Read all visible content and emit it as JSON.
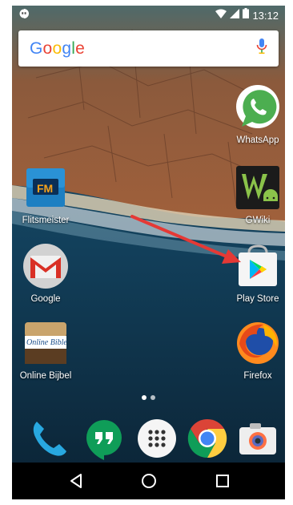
{
  "status_bar": {
    "time": "13:12",
    "icons": [
      "hangouts-notification-icon",
      "wifi-icon",
      "cell-signal-icon",
      "battery-icon"
    ]
  },
  "search": {
    "logo_text": "Google",
    "mic_icon": "mic-icon"
  },
  "home": {
    "apps": [
      {
        "label": "WhatsApp",
        "icon": "whatsapp-icon"
      },
      {
        "label": "Flitsmeister",
        "icon": "flitsmeister-icon"
      },
      {
        "label": "GWiki",
        "icon": "gwiki-icon"
      },
      {
        "label": "Google",
        "icon": "gmail-icon"
      },
      {
        "label": "Play Store",
        "icon": "play-store-icon"
      },
      {
        "label": "Online Bijbel",
        "icon": "online-bible-icon"
      },
      {
        "label": "Firefox",
        "icon": "firefox-icon"
      }
    ],
    "flitsmeister_badge": "FM",
    "bible_badge": "Online Bible",
    "page_indicator": {
      "pages": 2,
      "current": 1
    }
  },
  "dock": {
    "apps": [
      "phone-icon",
      "hangouts-icon",
      "app-drawer-icon",
      "chrome-icon",
      "camera-icon"
    ]
  },
  "nav": {
    "buttons": [
      "back-icon",
      "home-icon",
      "recents-icon"
    ]
  },
  "annotation": {
    "color": "#e53935",
    "points_to": "Play Store"
  }
}
